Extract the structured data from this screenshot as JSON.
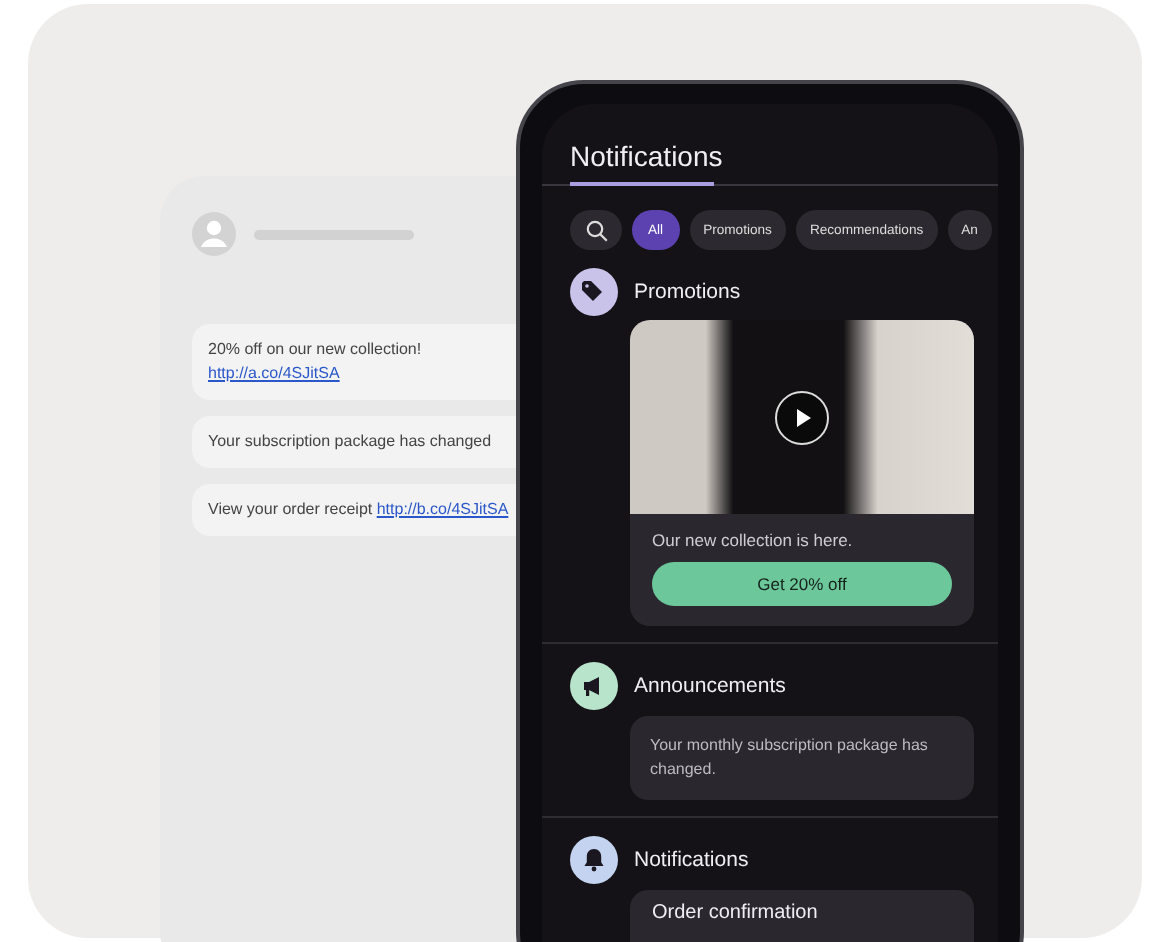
{
  "sms_phone": {
    "messages": [
      {
        "text": "20% off on our new collection! ",
        "link": "http://a.co/4SJitSA"
      },
      {
        "text": "Your subscription package has changed"
      },
      {
        "text": "View your order receipt ",
        "link": "http://b.co/4SJitSA"
      }
    ]
  },
  "app_phone": {
    "title": "Notifications",
    "filters": [
      {
        "label": "All",
        "selected": true
      },
      {
        "label": "Promotions",
        "selected": false
      },
      {
        "label": "Recommendations",
        "selected": false
      },
      {
        "label": "An",
        "selected": false
      }
    ],
    "sections": [
      {
        "kind": "promo",
        "title": "Promotions",
        "color": "#c9c3ea",
        "text": "Our new collection is here.",
        "button": "Get 20% off"
      },
      {
        "kind": "message",
        "title": "Announcements",
        "color": "#b9e4cc",
        "text": "Your monthly subscription package has changed."
      },
      {
        "kind": "card",
        "title": "Notifications",
        "color": "#c4d4f0",
        "text": "Order confirmation"
      }
    ]
  }
}
